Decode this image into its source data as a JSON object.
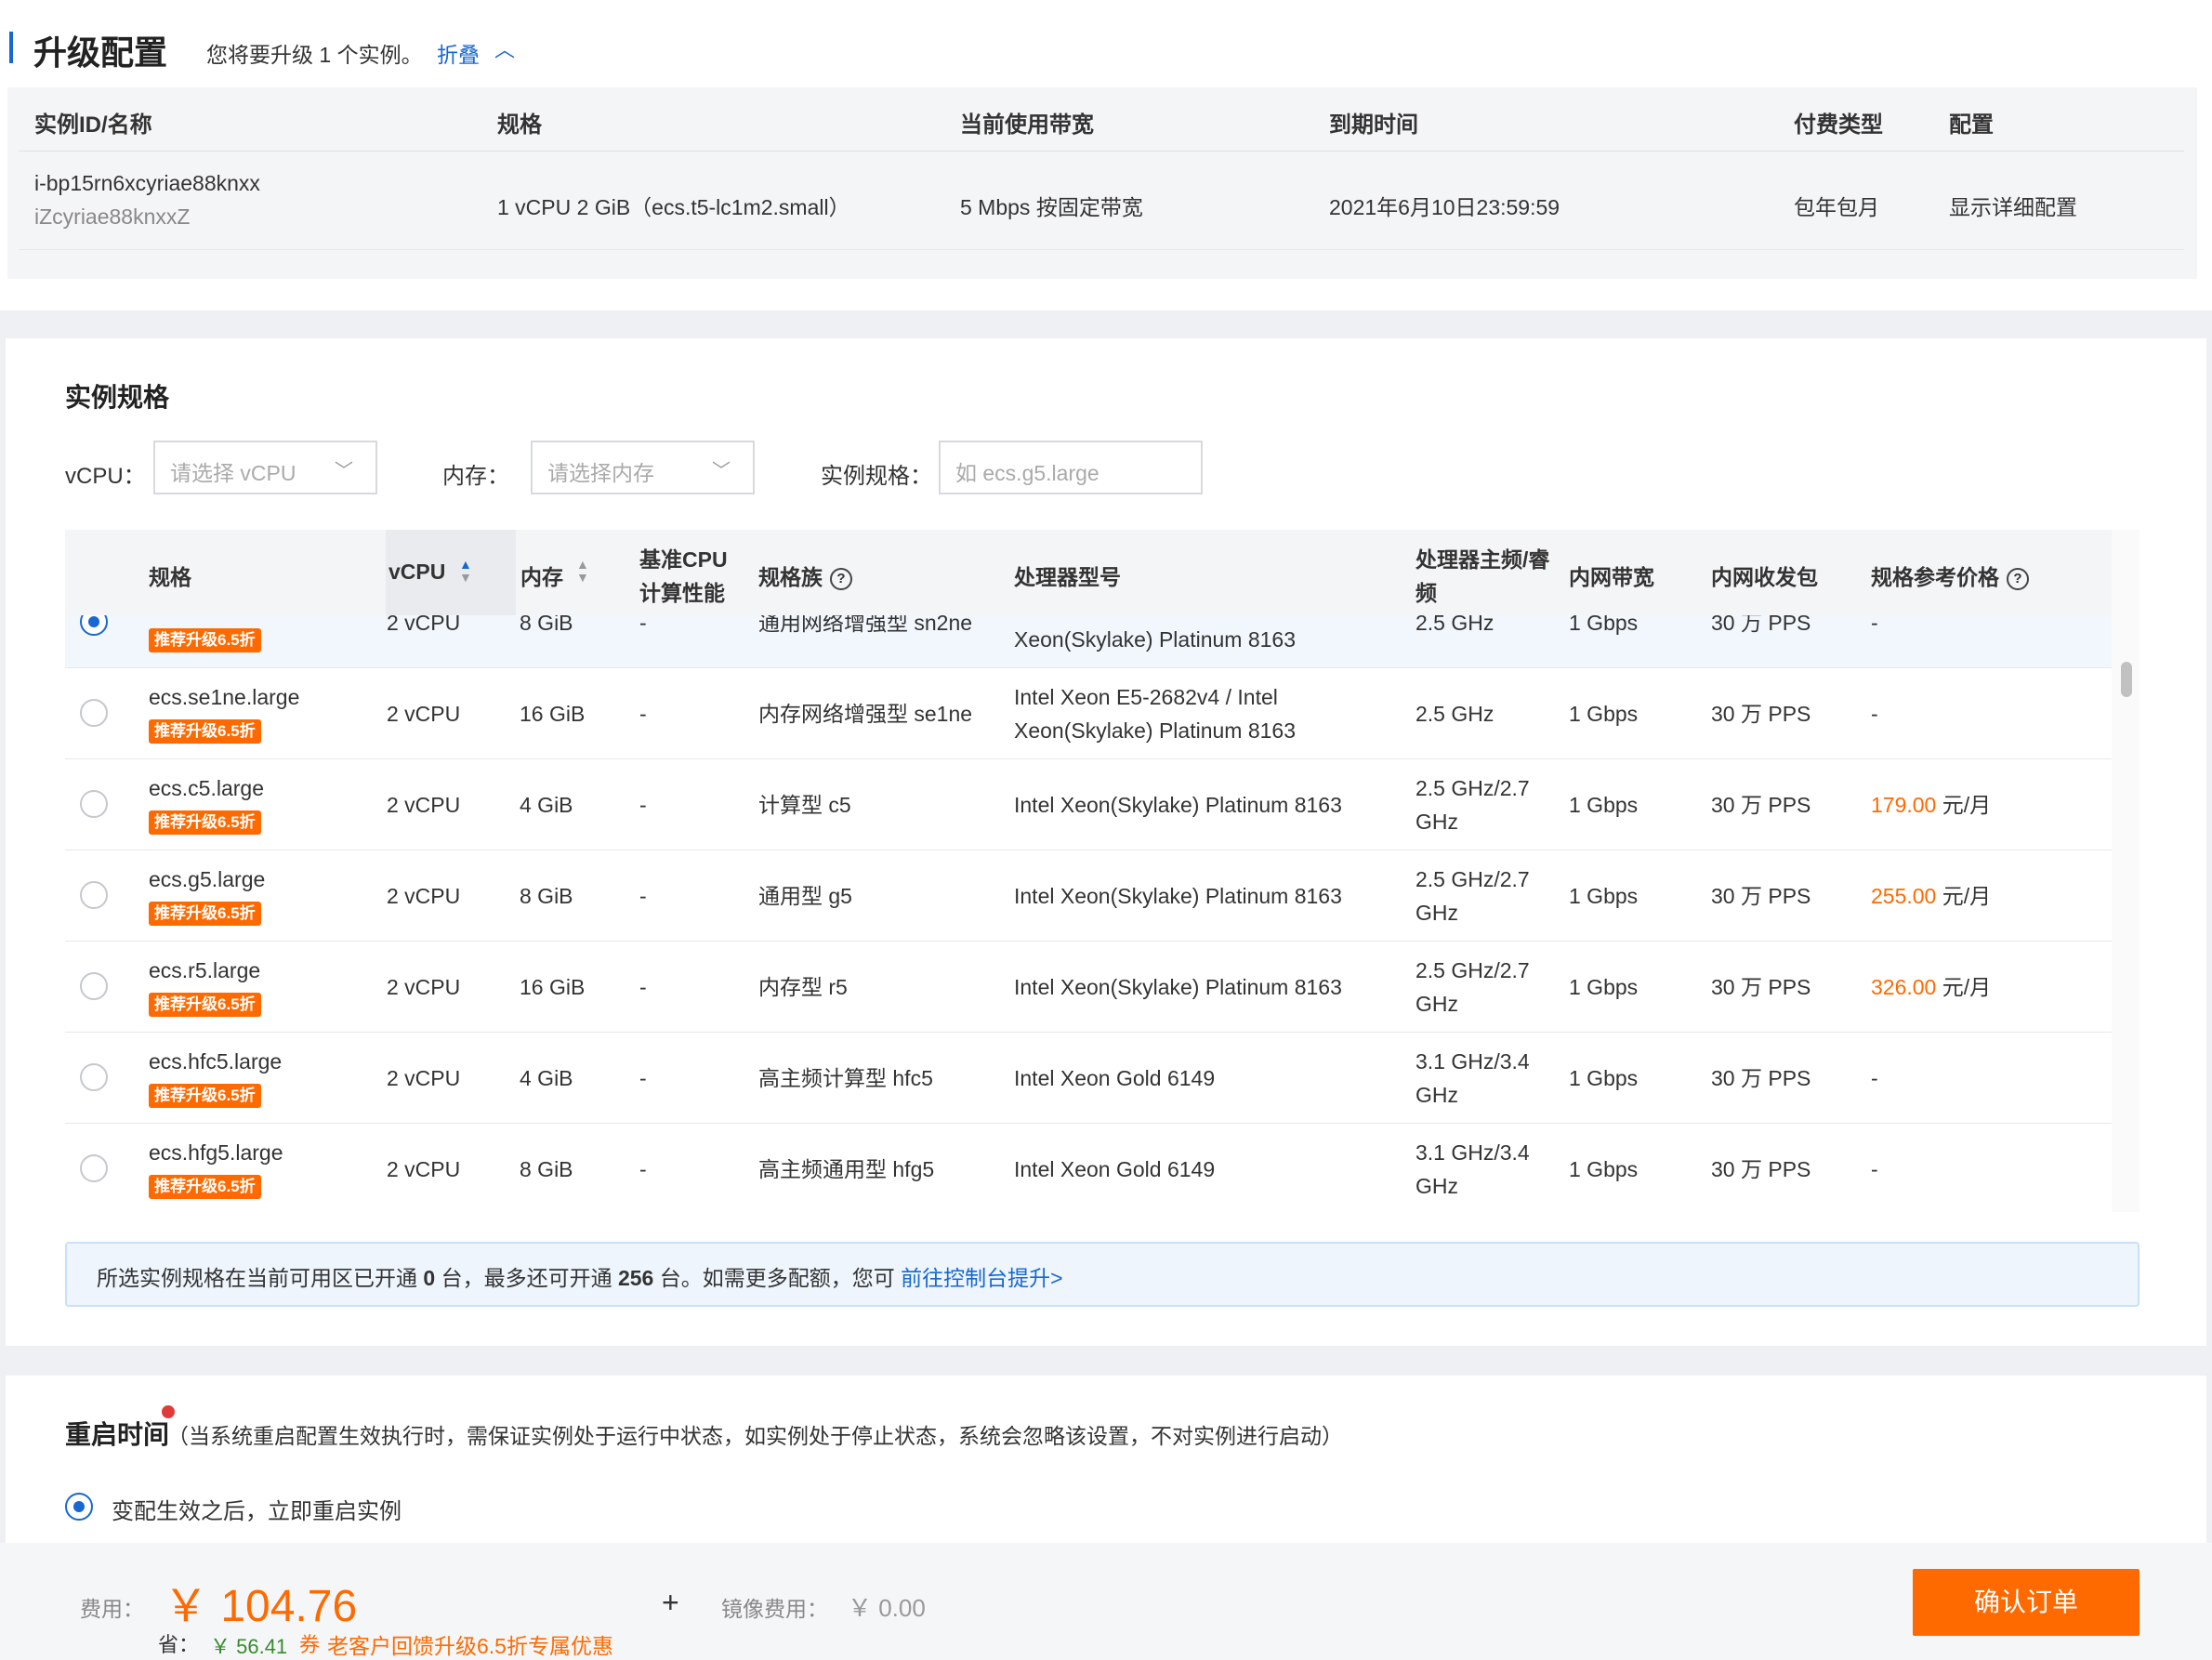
{
  "upgrade": {
    "title": "升级配置",
    "desc": "您将要升级 1 个实例。",
    "fold": "折叠",
    "columns": [
      "实例ID/名称",
      "规格",
      "当前使用带宽",
      "到期时间",
      "付费类型",
      "配置"
    ],
    "row": {
      "id": "i-bp15rn6xcyriae88knxx",
      "name": "iZcyriae88knxxZ",
      "spec": "1 vCPU 2 GiB（ecs.t5-lc1m2.small）",
      "bandwidth": "5 Mbps 按固定带宽",
      "expire": "2021年6月10日23:59:59",
      "pay": "包年包月",
      "detail": "显示详细配置"
    }
  },
  "spec": {
    "title": "实例规格",
    "filters": {
      "vcpu_label": "vCPU：",
      "vcpu_placeholder": "请选择 vCPU",
      "mem_label": "内存：",
      "mem_placeholder": "请选择内存",
      "type_label": "实例规格：",
      "type_placeholder": "如 ecs.g5.large"
    },
    "headers": {
      "spec": "规格",
      "vcpu": "vCPU",
      "mem": "内存",
      "base_cpu_1": "基准CPU",
      "base_cpu_2": "计算性能",
      "family": "规格族",
      "cpu_model": "处理器型号",
      "freq_1": "处理器主频/睿",
      "freq_2": "频",
      "bw": "内网带宽",
      "pps": "内网收发包",
      "price": "规格参考价格"
    },
    "badge": "推荐升级6.5折",
    "rows": [
      {
        "name": "",
        "vcpu": "2 vCPU",
        "mem": "8 GiB",
        "base": "-",
        "family": "通用网络增强型 sn2ne",
        "cpu1": "",
        "cpu2": "Xeon(Skylake) Platinum 8163",
        "f1": "2.5 GHz",
        "f2": "",
        "bw": "1 Gbps",
        "pps": "30 万 PPS",
        "price": "",
        "price_unit": "",
        "dash": "-"
      },
      {
        "name": "ecs.se1ne.large",
        "vcpu": "2 vCPU",
        "mem": "16 GiB",
        "base": "-",
        "family": "内存网络增强型 se1ne",
        "cpu1": "Intel Xeon E5-2682v4 / Intel",
        "cpu2": "Xeon(Skylake) Platinum 8163",
        "f1": "2.5 GHz",
        "f2": "",
        "bw": "1 Gbps",
        "pps": "30 万 PPS",
        "price": "",
        "price_unit": "",
        "dash": "-"
      },
      {
        "name": "ecs.c5.large",
        "vcpu": "2 vCPU",
        "mem": "4 GiB",
        "base": "-",
        "family": "计算型 c5",
        "cpu1": "Intel Xeon(Skylake) Platinum 8163",
        "cpu2": "",
        "f1": "2.5 GHz/2.7",
        "f2": "GHz",
        "bw": "1 Gbps",
        "pps": "30 万 PPS",
        "price": "179.00",
        "price_unit": " 元/月",
        "dash": ""
      },
      {
        "name": "ecs.g5.large",
        "vcpu": "2 vCPU",
        "mem": "8 GiB",
        "base": "-",
        "family": "通用型 g5",
        "cpu1": "Intel Xeon(Skylake) Platinum 8163",
        "cpu2": "",
        "f1": "2.5 GHz/2.7",
        "f2": "GHz",
        "bw": "1 Gbps",
        "pps": "30 万 PPS",
        "price": "255.00",
        "price_unit": " 元/月",
        "dash": ""
      },
      {
        "name": "ecs.r5.large",
        "vcpu": "2 vCPU",
        "mem": "16 GiB",
        "base": "-",
        "family": "内存型 r5",
        "cpu1": "Intel Xeon(Skylake) Platinum 8163",
        "cpu2": "",
        "f1": "2.5 GHz/2.7",
        "f2": "GHz",
        "bw": "1 Gbps",
        "pps": "30 万 PPS",
        "price": "326.00",
        "price_unit": " 元/月",
        "dash": ""
      },
      {
        "name": "ecs.hfc5.large",
        "vcpu": "2 vCPU",
        "mem": "4 GiB",
        "base": "-",
        "family": "高主频计算型 hfc5",
        "cpu1": "Intel Xeon Gold 6149",
        "cpu2": "",
        "f1": "3.1 GHz/3.4",
        "f2": "GHz",
        "bw": "1 Gbps",
        "pps": "30 万 PPS",
        "price": "",
        "price_unit": "",
        "dash": "-"
      },
      {
        "name": "ecs.hfg5.large",
        "vcpu": "2 vCPU",
        "mem": "8 GiB",
        "base": "-",
        "family": "高主频通用型 hfg5",
        "cpu1": "Intel Xeon Gold 6149",
        "cpu2": "",
        "f1": "3.1 GHz/3.4",
        "f2": "GHz",
        "bw": "1 Gbps",
        "pps": "30 万 PPS",
        "price": "",
        "price_unit": "",
        "dash": "-"
      }
    ],
    "notice": {
      "p1": "所选实例规格在当前可用区已开通 ",
      "n1": "0",
      "p2": " 台，最多还可开通 ",
      "n2": "256",
      "p3": " 台。如需更多配额，您可 ",
      "link": "前往控制台提升>"
    }
  },
  "restart": {
    "title": "重启时间",
    "note": "（当系统重启配置生效执行时，需保证实例处于运行中状态，如实例处于停止状态，系统会忽略该设置，不对实例进行启动）",
    "option": "变配生效之后，立即重启实例"
  },
  "footer": {
    "fee_label": "费用：",
    "fee": "￥ 104.76",
    "save_label": "省：",
    "save": "￥ 56.41",
    "promo_icon": "券",
    "promo": "老客户回馈升级6.5折专属优惠",
    "plus": "+",
    "image_label": "镜像费用：",
    "image_fee": "￥ 0.00",
    "confirm": "确认订单"
  },
  "colors": {
    "accent": "#1768d2",
    "orange": "#ff6a00"
  }
}
